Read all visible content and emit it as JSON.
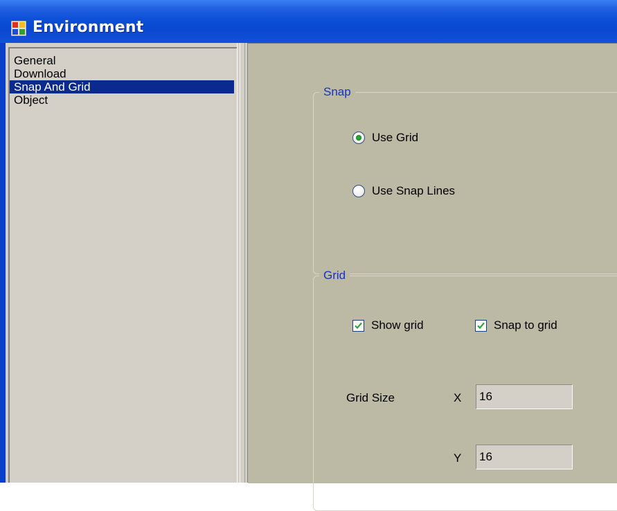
{
  "window": {
    "title": "Environment",
    "icon": "app-window-icon"
  },
  "nav": {
    "items": [
      {
        "label": "General",
        "selected": false
      },
      {
        "label": "Download",
        "selected": false
      },
      {
        "label": "Snap And Grid",
        "selected": true
      },
      {
        "label": "Object",
        "selected": false
      }
    ]
  },
  "snap": {
    "group_title": "Snap",
    "use_grid_label": "Use Grid",
    "use_grid_selected": true,
    "use_snap_lines_label": "Use Snap Lines",
    "use_snap_lines_selected": false
  },
  "grid": {
    "group_title": "Grid",
    "show_grid_label": "Show grid",
    "show_grid_checked": true,
    "snap_to_grid_label": "Snap to grid",
    "snap_to_grid_checked": true,
    "grid_size_label": "Grid Size",
    "x_label": "X",
    "x_value": "16",
    "y_label": "Y",
    "y_value": "16"
  },
  "colors": {
    "titlebar": "#0a48cf",
    "selection": "#0b2a8f",
    "group_title": "#1433c8",
    "panel_bg": "#bcb9a5",
    "check_green": "#27a83a"
  }
}
